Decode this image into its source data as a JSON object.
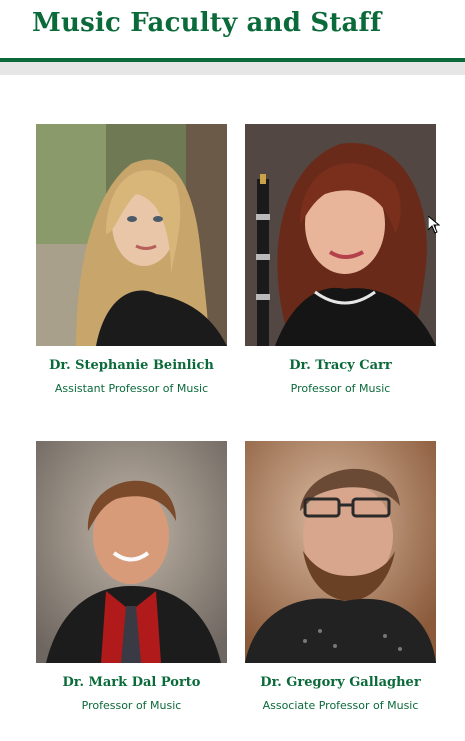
{
  "page": {
    "title": "Music Faculty and Staff"
  },
  "faculty": [
    {
      "name": "Dr. Stephanie Beinlich",
      "title": "Assistant Professor of Music"
    },
    {
      "name": "Dr. Tracy Carr",
      "title": "Professor of Music"
    },
    {
      "name": "Dr. Mark Dal Porto",
      "title": "Professor of Music"
    },
    {
      "name": "Dr. Gregory Gallagher",
      "title": "Associate Professor of Music"
    }
  ],
  "colors": {
    "brand_green": "#0b6a3a",
    "band_gray": "#e6e6e6"
  },
  "icons": [
    "mouse-cursor-icon"
  ]
}
